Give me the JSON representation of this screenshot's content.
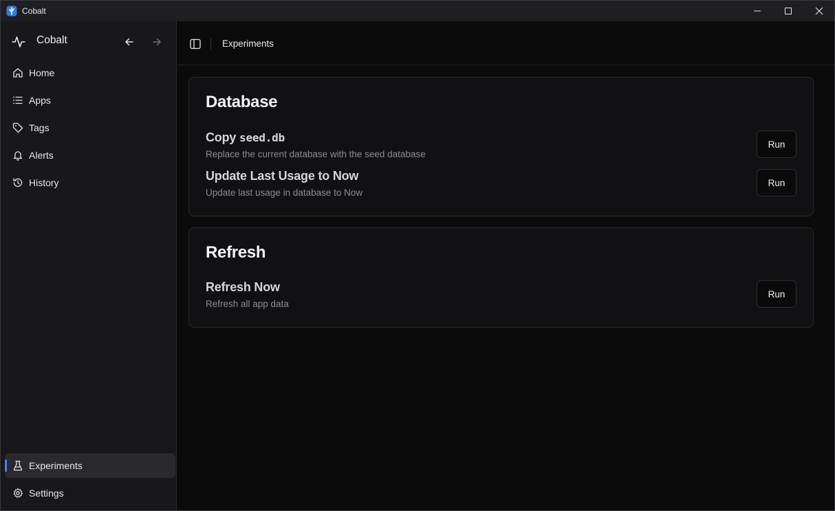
{
  "window": {
    "title": "Cobalt",
    "controls": [
      "minimize-icon",
      "maximize-icon",
      "close-icon"
    ]
  },
  "sidebar": {
    "brand": "Cobalt",
    "nav_top": [
      {
        "label": "Home",
        "icon": "home-icon"
      },
      {
        "label": "Apps",
        "icon": "list-icon"
      },
      {
        "label": "Tags",
        "icon": "tag-icon"
      },
      {
        "label": "Alerts",
        "icon": "bell-icon"
      },
      {
        "label": "History",
        "icon": "history-icon"
      }
    ],
    "nav_bottom": [
      {
        "label": "Experiments",
        "icon": "flask-icon",
        "active": true
      },
      {
        "label": "Settings",
        "icon": "gear-icon"
      }
    ]
  },
  "header": {
    "breadcrumb": "Experiments"
  },
  "sections": [
    {
      "title": "Database",
      "rows": [
        {
          "title_prefix": "Copy ",
          "title_code": "seed.db",
          "description": "Replace the current database with the seed database",
          "button": "Run"
        },
        {
          "title": "Update Last Usage to Now",
          "description": "Update last usage in database to Now",
          "button": "Run"
        }
      ]
    },
    {
      "title": "Refresh",
      "rows": [
        {
          "title": "Refresh Now",
          "description": "Refresh all app data",
          "button": "Run"
        }
      ]
    }
  ],
  "colors": {
    "accent": "#4a7bf7",
    "background": "#0b0b0c",
    "sidebar": "#18181a",
    "card": "#111113"
  }
}
